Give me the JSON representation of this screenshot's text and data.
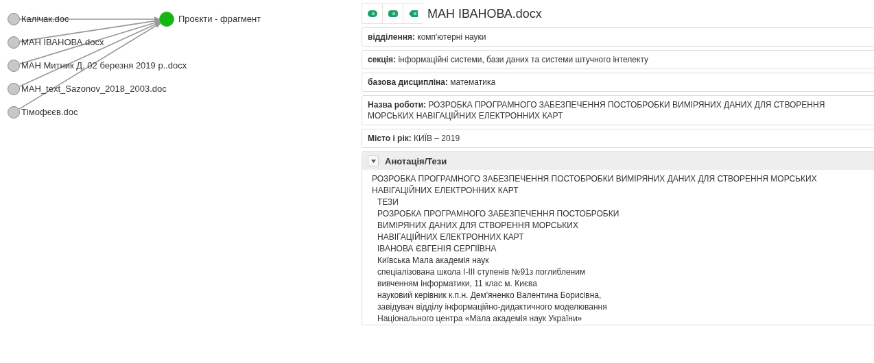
{
  "graph": {
    "target": {
      "label": "Проєкти - фрагмент"
    },
    "sources": [
      {
        "label": "Калічак.doc"
      },
      {
        "label": "МАН ІВАНОВА.docx"
      },
      {
        "label": "МАН Митник Д. 02 березня 2019 р..docx"
      },
      {
        "label": "МАН_text_Sazonov_2018_2003.doc"
      },
      {
        "label": "Тімофєєв.doc"
      }
    ]
  },
  "document": {
    "title": "МАН ІВАНОВА.docx",
    "fields": [
      {
        "label": "відділення:",
        "value": "комп'ютерні науки"
      },
      {
        "label": "секція:",
        "value": "інформаційні системи, бази даних та системи штучного інтелекту"
      },
      {
        "label": "базова дисципліна:",
        "value": "математика"
      },
      {
        "label": "Назва роботи:",
        "value": "РОЗРОБКА ПРОГРАМНОГО ЗАБЕЗПЕЧЕННЯ ПОСТОБРОБКИ ВИМІРЯНИХ ДАНИХ ДЛЯ СТВОРЕННЯ МОРСЬКИХ НАВІГАЦІЙНИХ ЕЛЕКТРОННИХ КАРТ"
      },
      {
        "label": "Місто і рік:",
        "value": "КИЇВ – 2019"
      }
    ],
    "abstract": {
      "title": "Анотація/Тези",
      "expanded": true,
      "lines": [
        {
          "kind": "lead",
          "text": "РОЗРОБКА ПРОГРАМНОГО ЗАБЕЗПЕЧЕННЯ ПОСТОБРОБКИ ВИМІРЯНИХ ДАНИХ ДЛЯ СТВОРЕННЯ МОРСЬКИХ НАВІГАЦІЙНИХ ЕЛЕКТРОННИХ КАРТ"
        },
        {
          "kind": "line",
          "text": "ТЕЗИ"
        },
        {
          "kind": "line",
          "text": "РОЗРОБКА ПРОГРАМНОГО ЗАБЕЗПЕЧЕННЯ ПОСТОБРОБКИ"
        },
        {
          "kind": "line",
          "text": "ВИМІРЯНИХ ДАНИХ ДЛЯ СТВОРЕННЯ МОРСЬКИХ"
        },
        {
          "kind": "line",
          "text": "НАВІГАЦІЙНИХ ЕЛЕКТРОННИХ КАРТ"
        },
        {
          "kind": "line",
          "text": "ІВАНОВА ЄВГЕНІЯ СЕРГІЇВНА"
        },
        {
          "kind": "line",
          "text": "Київська Мала академія наук"
        },
        {
          "kind": "line",
          "text": "спеціалізована школа I-III ступенів №91з поглибленим"
        },
        {
          "kind": "line",
          "text": "вивченням інформатики, 11 клас м. Києва"
        },
        {
          "kind": "line",
          "text": "науковий керівник к.п.н. Дем'яненко Валентина Борисівна,"
        },
        {
          "kind": "line",
          "text": "завідувач відділу інформаційно-дидактичного моделювання"
        },
        {
          "kind": "line",
          "text": "Національного центра «Мала академія наук України»"
        }
      ]
    }
  }
}
